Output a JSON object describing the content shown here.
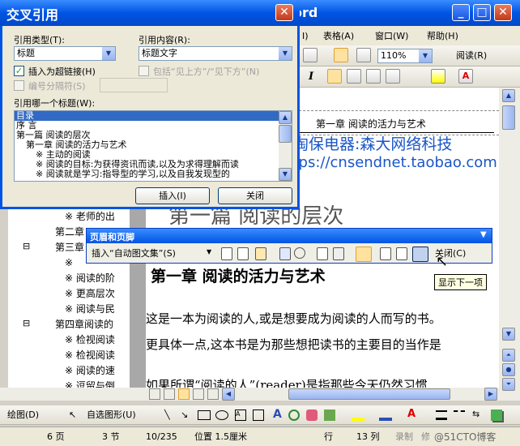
{
  "window": {
    "title_fragment": "ord"
  },
  "menu": {
    "insert_fragment": "I)",
    "table": "表格(A)",
    "window": "窗口(W)",
    "help": "帮助(H)"
  },
  "toolbar": {
    "zoom": "110%",
    "read": "阅读(R)",
    "italic": "I"
  },
  "dialog": {
    "title": "交叉引用",
    "ref_type_label": "引用类型(T):",
    "ref_type_value": "标题",
    "ref_content_label": "引用内容(R):",
    "ref_content_value": "标题文字",
    "insert_hyperlink": "插入为超链接(H)",
    "include_above_below": "包括“见上方”/“见下方”(N)",
    "number_separator": "编号分隔符(S)",
    "which_heading": "引用哪一个标题(W):",
    "list": [
      "目录",
      "序 言",
      "第一篇 阅读的层次",
      "第一章 阅读的活力与艺术",
      "※ 主动的阅读",
      "※ 阅读的目标:为获得资讯而读,以及为求得理解而读",
      "※ 阅读就是学习:指导型的学习,以及自我发现型的"
    ],
    "insert_btn": "插入(I)",
    "close_btn": "关闭"
  },
  "outline": [
    {
      "text": "※ 老师的出",
      "level": 2
    },
    {
      "text": "第二章",
      "level": 1
    },
    {
      "text": "第三章",
      "level": 1,
      "collapse": "⊟"
    },
    {
      "text": "※",
      "level": 2
    },
    {
      "text": "※ 阅读的阶",
      "level": 2
    },
    {
      "text": "※ 更高层次",
      "level": 2
    },
    {
      "text": "※ 阅读与民",
      "level": 2
    },
    {
      "text": "第四章阅读的",
      "level": 1,
      "collapse": "⊟"
    },
    {
      "text": "※ 检视阅读",
      "level": 2
    },
    {
      "text": "※ 检视阅读",
      "level": 2
    },
    {
      "text": "※ 阅读的速",
      "level": 2
    },
    {
      "text": "※ 逗留与倒",
      "level": 2
    }
  ],
  "document": {
    "header_chapter": "第一章 阅读的活力与艺术",
    "watermark_1": "搜淘保电器:森大网络科技",
    "watermark_2": "https://cnsendnet.taobao.com",
    "part_title": "第一篇 阅读的层次",
    "chapter_title": "第一章 阅读的活力与艺术",
    "para_1": "这是一本为阅读的人,或是想要成为阅读的人而写的书。",
    "para_2": "更具体一点,这本书是为那些想把读书的主要目的当作是",
    "para_3": "如果所谓“阅读的人”(reader)是指那些今天仍然习惯"
  },
  "header_footer_toolbar": {
    "title": "页眉和页脚",
    "insert_autotext": "插入“自动图文集”(S)",
    "close": "关闭(C)",
    "tooltip": "显示下一项"
  },
  "draw_toolbar": {
    "draw": "绘图(D)",
    "autoshapes": "自选图形(U)"
  },
  "status": {
    "page": "6 页",
    "section": "3 节",
    "pages": "10/235",
    "position": "位置 1.5厘米",
    "line": "行",
    "col": "13 列",
    "record": "录制",
    "revise": "修",
    "watermark": "@51CTO博客"
  },
  "colors": {
    "accent": "#0a246a",
    "xp_blue": "#0054e3",
    "title_blue": "#3a6ff7",
    "watermark": "#1a56c8"
  }
}
